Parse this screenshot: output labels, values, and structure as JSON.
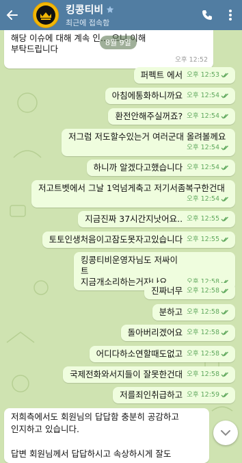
{
  "header": {
    "title": "킹콩티비",
    "subtitle": "최근에 접속함"
  },
  "date_badge": "8월 9일",
  "messages": [
    {
      "dir": "in",
      "text": "해당 이슈에 대해 계속 인…           으니 이해\n부탁드립니다",
      "time": "오후 12:52"
    },
    {
      "dir": "out",
      "text": "퍼펙트 에서",
      "time": "오후 12:53"
    },
    {
      "dir": "out",
      "text": "아침에통화하니까요",
      "time": "오후 12:54"
    },
    {
      "dir": "out",
      "text": "환전안해주실꺼죠?",
      "time": "오후 12:54"
    },
    {
      "dir": "out",
      "text": "저그럼 저도할수있는거 여러군대 올려볼께요",
      "time": "오후 12:54"
    },
    {
      "dir": "out",
      "text": "하니까 알겠다고했습니다",
      "time": "오후 12:54"
    },
    {
      "dir": "out",
      "text": "저고트벳에서 그날 1억넘게축고 저기서좀복구한건대",
      "time": "오후 12:54"
    },
    {
      "dir": "out",
      "text": "지금진짜 37시간지낫어요..",
      "time": "오후 12:55"
    },
    {
      "dir": "out",
      "text": "토토인생처음이고잠도못자고있습니다",
      "time": "오후 12:55"
    },
    {
      "dir": "out",
      "text": "킹콩티비운영자님도 저싸이트\n지금개소리하는거자나요..",
      "time": "오후 12:58"
    },
    {
      "dir": "out",
      "text": "진짜너무",
      "time": "오후 12:58"
    },
    {
      "dir": "out",
      "text": "분하고",
      "time": "오후 12:58"
    },
    {
      "dir": "out",
      "text": "돌아버리겠어요",
      "time": "오후 12:58"
    },
    {
      "dir": "out",
      "text": "어디다하소연할때도없고",
      "time": "오후 12:58"
    },
    {
      "dir": "out",
      "text": "국제전화와서지들이 잘못한건대",
      "time": "오후 12:58"
    },
    {
      "dir": "out",
      "text": "저를죄인취급하고",
      "time": "오후 12:59"
    },
    {
      "dir": "in",
      "text": "저희측에서도 회원님의 답답함 충분히 공감하고\n인지하고 있습니다.\n\n답변 회원님께서 답답하시고 속상하시게 잘도",
      "time": ""
    }
  ],
  "colors": {
    "header": "#517da2",
    "out_bubble": "#effdde",
    "in_bubble": "#ffffff",
    "check": "#5fa85c"
  },
  "icons": [
    "back-arrow-icon",
    "verified-star-icon",
    "phone-icon",
    "more-vert-icon",
    "double-check-icon",
    "chevron-down-icon"
  ]
}
